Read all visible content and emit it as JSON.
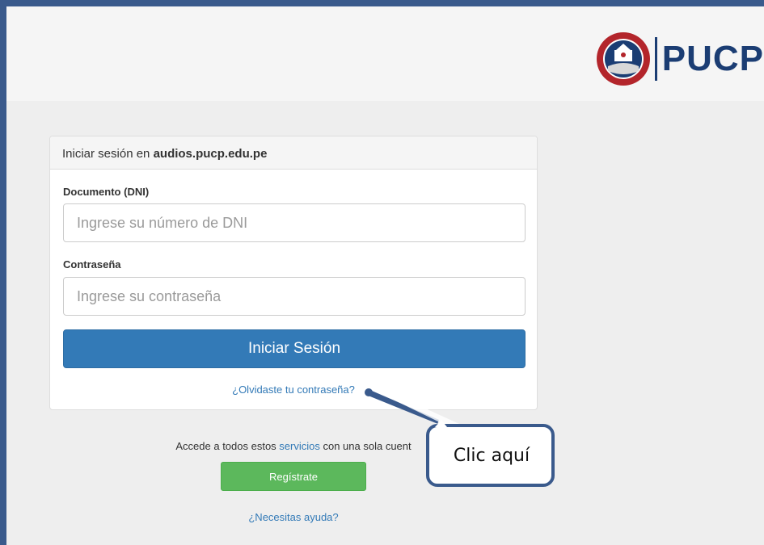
{
  "header": {
    "brand": "PUCP",
    "seal_motto": "ET LUX IN TENEBRIS LUCET",
    "seal_year": "MCMXVII"
  },
  "login": {
    "heading_prefix": "Iniciar sesión en ",
    "heading_site": "audios.pucp.edu.pe",
    "dni_label": "Documento (DNI)",
    "dni_placeholder": "Ingrese su número de DNI",
    "password_label": "Contraseña",
    "password_placeholder": "Ingrese su contraseña",
    "submit_label": "Iniciar Sesión",
    "forgot_link": "¿Olvidaste tu contraseña?"
  },
  "footer": {
    "services_prefix": "Accede a todos estos ",
    "services_link": "servicios",
    "services_suffix": " con una sola cuent",
    "register_label": "Regístrate",
    "help_link": "¿Necesitas ayuda?"
  },
  "callout": {
    "text": "Clic aquí"
  },
  "colors": {
    "primary": "#337ab7",
    "success": "#5cb85c",
    "brand": "#1b3d73",
    "frame": "#3a5a8c"
  }
}
